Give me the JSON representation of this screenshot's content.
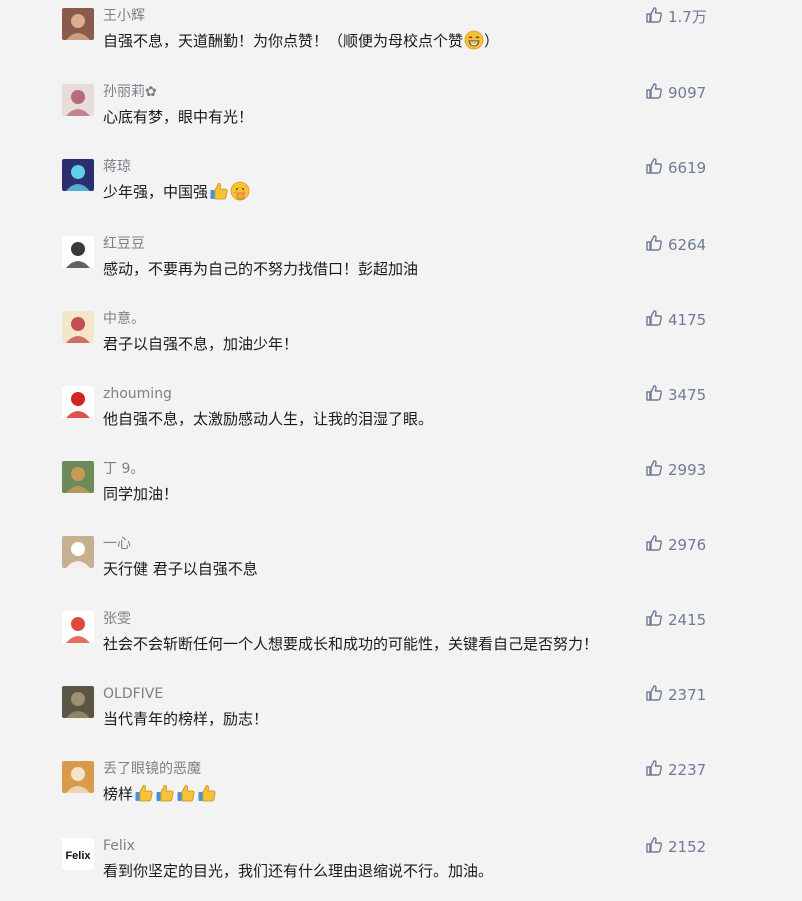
{
  "colors": {
    "background": "#f3f3f3",
    "username": "#7d8086",
    "comment_text": "#1a1a1a",
    "like": "#6f7b94"
  },
  "comments": [
    {
      "name": "王小辉",
      "text": "自强不息，天道酬勤！为你点赞！（顺便为母校点个赞",
      "text_suffix": "）",
      "emoji": [
        "grin-emoji"
      ],
      "likes": "1.7万"
    },
    {
      "name": "孙丽莉✿",
      "text": "心底有梦，眼中有光！",
      "emoji": [],
      "likes": "9097"
    },
    {
      "name": "蒋琼",
      "text": "少年强，中国强",
      "emoji": [
        "thumbs-up-emoji",
        "shush-emoji"
      ],
      "likes": "6619"
    },
    {
      "name": "红豆豆",
      "text": "感动，不要再为自己的不努力找借口！彭超加油",
      "emoji": [],
      "likes": "6264"
    },
    {
      "name": "中意。",
      "text": "君子以自强不息，加油少年！",
      "emoji": [],
      "likes": "4175"
    },
    {
      "name": "zhouming",
      "text": "他自强不息，太激励感动人生，让我的泪湿了眼。",
      "emoji": [],
      "likes": "3475"
    },
    {
      "name": "丁 9。",
      "text": "同学加油！",
      "emoji": [],
      "likes": "2993"
    },
    {
      "name": "一心",
      "text": "天行健 君子以自强不息",
      "emoji": [],
      "likes": "2976"
    },
    {
      "name": "张雯",
      "text": "社会不会斩断任何一个人想要成长和成功的可能性，关键看自己是否努力！",
      "emoji": [],
      "likes": "2415"
    },
    {
      "name": "OLDFIVE",
      "text": "当代青年的榜样，励志！",
      "emoji": [],
      "likes": "2371"
    },
    {
      "name": "丢了眼镜的恶魔",
      "text": "榜样",
      "emoji": [
        "thumbs-up-emoji",
        "thumbs-up-emoji",
        "thumbs-up-emoji",
        "thumbs-up-emoji"
      ],
      "likes": "2237"
    },
    {
      "name": "Felix",
      "text": "看到你坚定的目光，我们还有什么理由退缩说不行。加油。",
      "emoji": [],
      "likes": "2152",
      "avatar_text": "Felix"
    }
  ]
}
